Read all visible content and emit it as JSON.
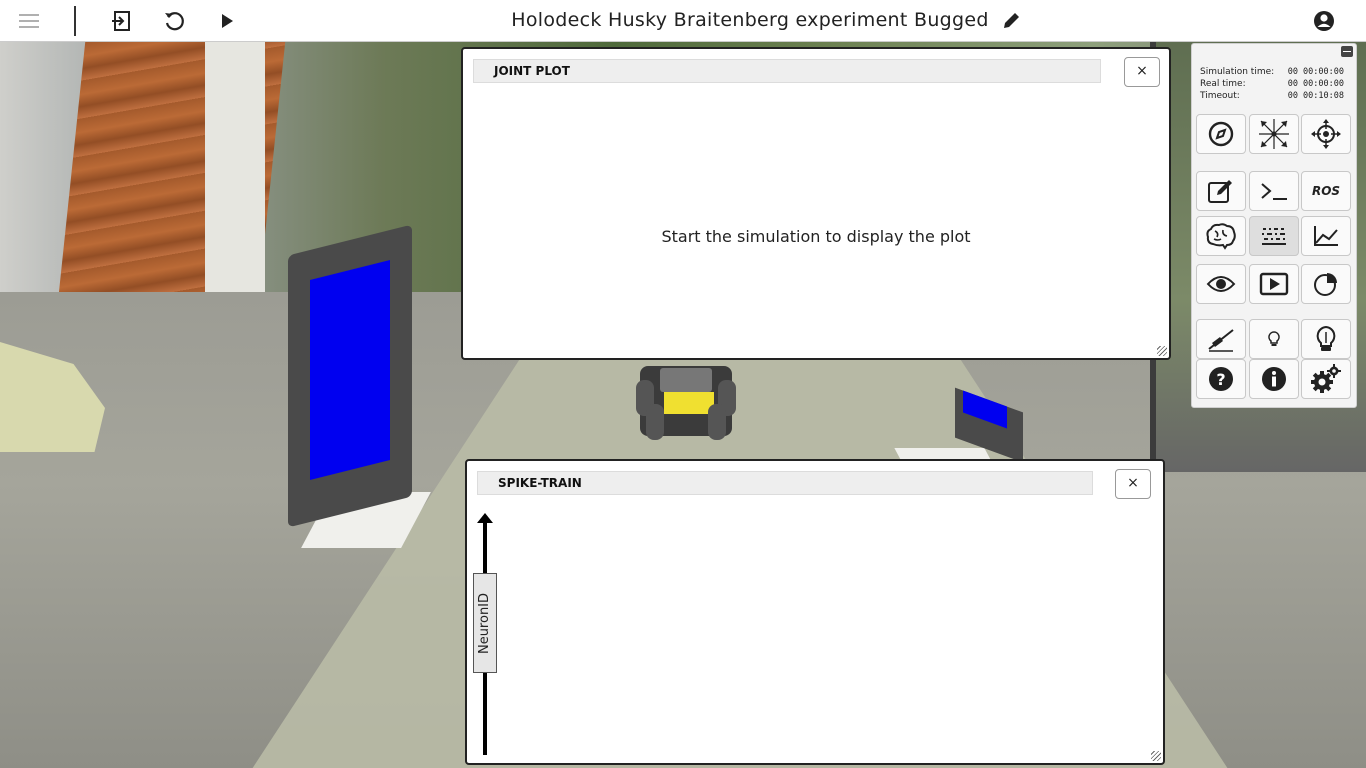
{
  "header": {
    "title": "Holodeck Husky Braitenberg experiment Bugged",
    "icons": [
      "menu-icon",
      "exit-icon",
      "reset-icon",
      "play-icon",
      "edit-icon",
      "user-icon"
    ]
  },
  "joint_plot": {
    "title": "JOINT PLOT",
    "close_label": "×",
    "message": "Start the simulation to display the plot"
  },
  "spike_train": {
    "title": "SPIKE-TRAIN",
    "close_label": "×",
    "y_axis_label": "NeuronID"
  },
  "toolbar": {
    "simulation_time_label": "Simulation time:",
    "simulation_time_value": "00 00:00:00",
    "real_time_label": "Real time:",
    "real_time_value": "00 00:00:00",
    "timeout_label": "Timeout:",
    "timeout_value": "00 00:10:08",
    "ros_label": "ROS",
    "buttons": [
      "orbit-camera-icon",
      "move-object-icon",
      "translate-object-icon",
      "edit-icon",
      "terminal-icon",
      "ros-icon",
      "brain-icon",
      "spike-train-icon",
      "joint-plot-icon",
      "eye-icon",
      "video-icon",
      "pie-chart-icon",
      "slider-icon",
      "small-light-icon",
      "large-light-icon",
      "help-icon",
      "info-icon",
      "settings-icon"
    ]
  },
  "colors": {
    "screen_blue": "#0000f0",
    "robot_yellow": "#f0e030",
    "panel_border": "#222222"
  }
}
